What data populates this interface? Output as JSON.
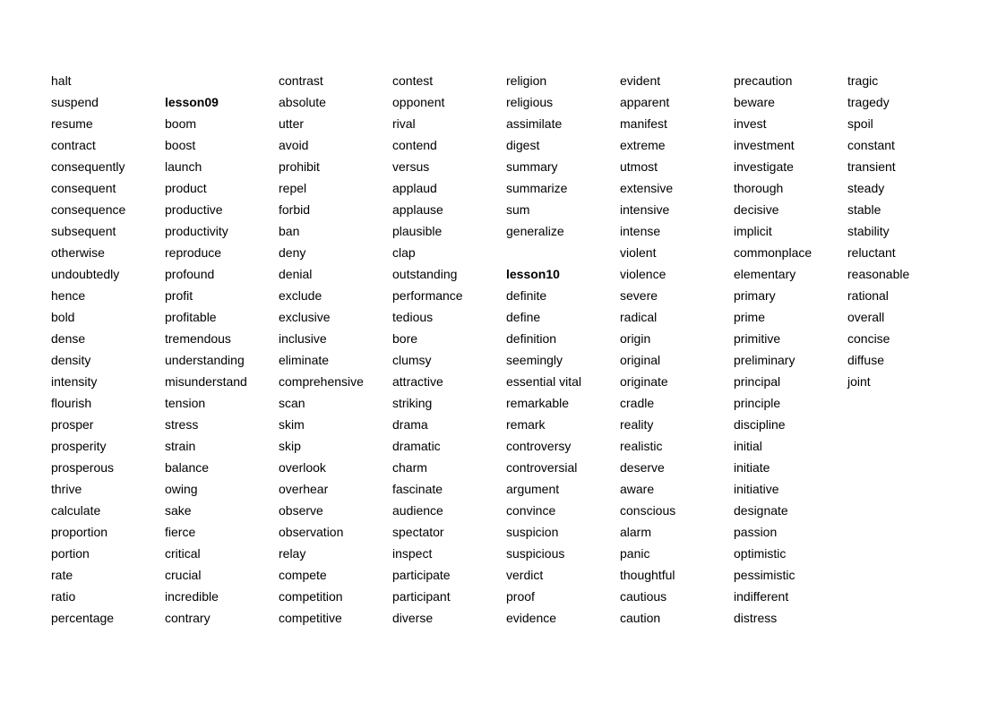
{
  "headings": [
    "lesson09",
    "lesson10"
  ],
  "columns": [
    [
      "halt",
      "suspend",
      "resume",
      "contract",
      "consequently",
      "consequent",
      "consequence",
      "subsequent",
      "otherwise",
      "undoubtedly",
      "hence",
      "bold",
      "dense",
      "density",
      "intensity",
      "flourish",
      "prosper",
      "prosperity",
      "prosperous",
      "thrive",
      "calculate",
      "proportion",
      "portion",
      "rate",
      "ratio",
      "percentage"
    ],
    [
      "",
      "lesson09",
      "boom",
      "boost",
      "launch",
      "product",
      "productive",
      "productivity",
      "reproduce",
      "profound",
      "profit",
      "profitable",
      "tremendous",
      "understanding",
      "misunderstand",
      "tension",
      "stress",
      "strain",
      "balance",
      "owing",
      "sake",
      "fierce",
      "critical",
      "crucial",
      "incredible",
      "contrary"
    ],
    [
      "contrast",
      "absolute",
      "utter",
      "avoid",
      "prohibit",
      "repel",
      "forbid",
      "ban",
      "deny",
      "denial",
      "exclude",
      "exclusive",
      "inclusive",
      "eliminate",
      "comprehensive",
      "scan",
      "skim",
      "skip",
      "overlook",
      "overhear",
      "observe",
      "observation",
      "relay",
      "compete",
      "competition",
      "competitive"
    ],
    [
      "contest",
      "opponent",
      "rival",
      "contend",
      "versus",
      "applaud",
      "applause",
      "plausible",
      "clap",
      "outstanding",
      "performance",
      "tedious",
      "bore",
      "clumsy",
      "attractive",
      "striking",
      "drama",
      "dramatic",
      "charm",
      "fascinate",
      "audience",
      "spectator",
      "inspect",
      "participate",
      "participant",
      "diverse"
    ],
    [
      "religion",
      "religious",
      "assimilate",
      "digest",
      "summary",
      "summarize",
      "sum",
      "generalize",
      "",
      "lesson10",
      "definite",
      "define",
      "definition",
      "seemingly",
      "essential vital",
      "remarkable",
      "remark",
      "controversy",
      "controversial",
      "argument",
      "convince",
      "suspicion",
      "suspicious",
      "verdict",
      "proof",
      "evidence"
    ],
    [
      "evident",
      "apparent",
      "manifest",
      "extreme",
      "utmost",
      "extensive",
      "intensive",
      "intense",
      "violent",
      "violence",
      "severe",
      "radical",
      "origin",
      "original",
      "originate",
      "cradle",
      "reality",
      "realistic",
      "deserve",
      "aware",
      "conscious",
      "alarm",
      "panic",
      "thoughtful",
      "cautious",
      "caution"
    ],
    [
      "precaution",
      "beware",
      "invest",
      "investment",
      "investigate",
      "thorough",
      "decisive",
      "implicit",
      "commonplace",
      "elementary",
      "primary",
      "prime",
      "primitive",
      "preliminary",
      "principal",
      "principle",
      "discipline",
      "initial",
      "initiate",
      "initiative",
      "designate",
      "passion",
      "optimistic",
      "pessimistic",
      "indifferent",
      "distress"
    ],
    [
      "tragic",
      "tragedy",
      "spoil",
      "constant",
      "transient",
      "steady",
      "stable",
      "stability",
      "reluctant",
      "reasonable",
      "rational",
      "overall",
      "concise",
      "diffuse",
      "joint"
    ]
  ]
}
